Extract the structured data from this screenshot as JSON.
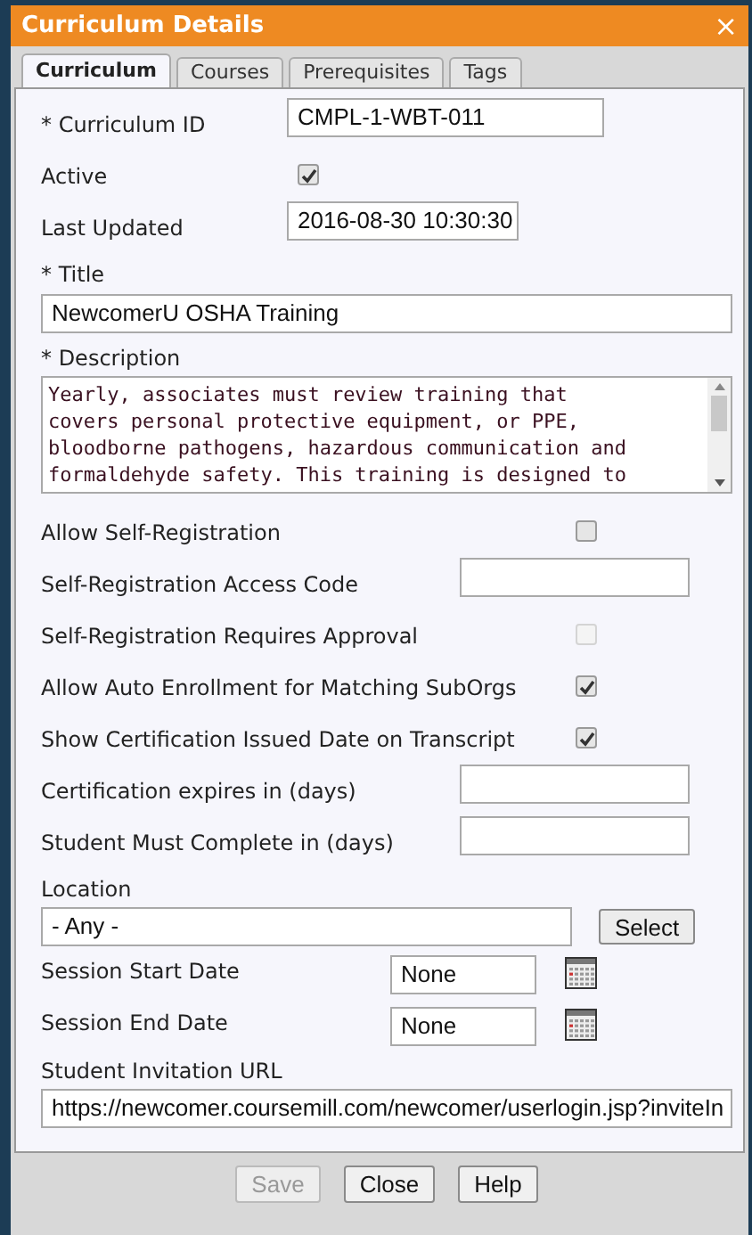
{
  "window": {
    "title": "Curriculum Details",
    "close": "×"
  },
  "tabs": [
    {
      "label": "Curriculum",
      "selected": true
    },
    {
      "label": "Courses",
      "selected": false
    },
    {
      "label": "Prerequisites",
      "selected": false
    },
    {
      "label": "Tags",
      "selected": false
    }
  ],
  "header_fields": [
    {
      "kind": "text",
      "label": "* Curriculum ID",
      "value": "CMPL-1-WBT-011"
    },
    {
      "kind": "checkbox",
      "label": "Active",
      "checked": true,
      "disabled": false
    },
    {
      "kind": "text",
      "label": "Last Updated",
      "value": "2016-08-30 10:30:30"
    }
  ],
  "title_field": {
    "label": "* Title",
    "value": "NewcomerU OSHA Training"
  },
  "description_field": {
    "label": "* Description",
    "lines": [
      "Yearly, associates must review training that",
      "covers personal protective equipment, or PPE,",
      "bloodborne pathogens, hazardous communication and",
      "formaldehyde safety. This training is designed to"
    ]
  },
  "options": [
    {
      "kind": "checkbox",
      "label": "Allow Self-Registration",
      "checked": false,
      "disabled": false
    },
    {
      "kind": "text",
      "label": "Self-Registration Access Code"
    },
    {
      "kind": "checkbox",
      "label": "Self-Registration Requires Approval",
      "checked": false,
      "disabled": true
    },
    {
      "kind": "checkbox",
      "label": "Allow Auto Enrollment for Matching SubOrgs",
      "checked": true,
      "disabled": false
    },
    {
      "kind": "checkbox",
      "label": "Show Certification Issued Date on Transcript",
      "checked": true,
      "disabled": false
    },
    {
      "kind": "text",
      "label": "Certification expires in (days)"
    },
    {
      "kind": "text",
      "label": "Student Must Complete in (days)"
    }
  ],
  "location": {
    "label": "Location",
    "value": "- Any -",
    "button": "Select"
  },
  "dates": [
    {
      "label": "Session Start Date",
      "value": "None"
    },
    {
      "label": "Session End Date",
      "value": "None"
    }
  ],
  "invitation": {
    "label": "Student Invitation URL",
    "value": "https://newcomer.coursemill.com/newcomer/userlogin.jsp?inviteIn"
  },
  "buttons": [
    {
      "label": "Save",
      "disabled": true
    },
    {
      "label": "Close",
      "disabled": false
    },
    {
      "label": "Help",
      "disabled": false
    }
  ]
}
